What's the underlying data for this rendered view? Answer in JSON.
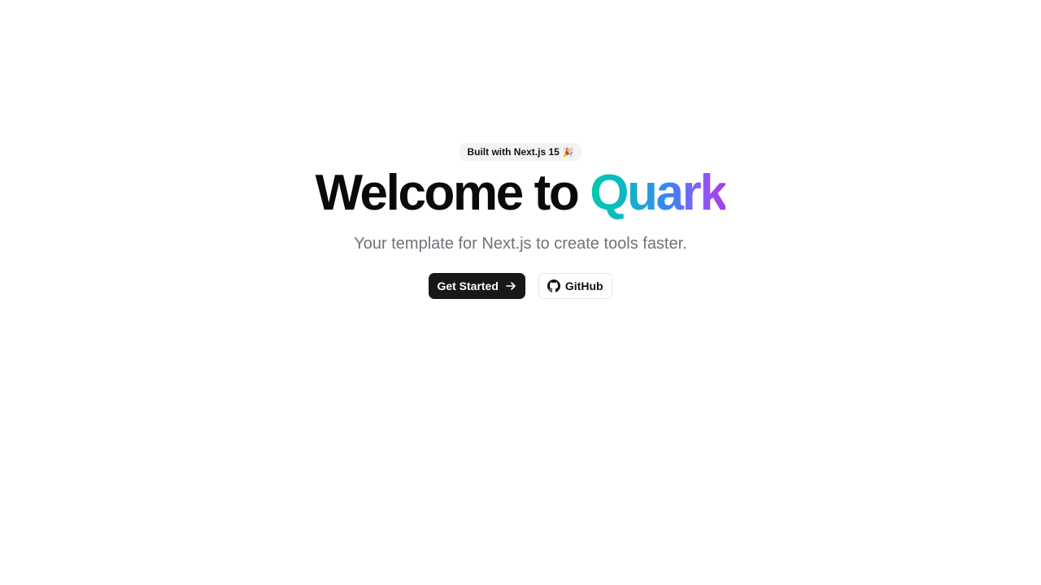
{
  "hero": {
    "badge": {
      "text": "Built with Next.js 15",
      "emoji": "🎉"
    },
    "title": {
      "prefix": "Welcome to",
      "brand": "Quark"
    },
    "subtitle": "Your template for Next.js to create tools faster.",
    "actions": {
      "primary_label": "Get Started",
      "primary_icon": "arrow-right-icon",
      "secondary_label": "GitHub",
      "secondary_icon": "github-icon"
    }
  },
  "colors": {
    "background": "#ffffff",
    "text": "#0a0a0a",
    "muted": "#71717a",
    "primary_button": "#18181b",
    "gradient_start": "#00c9a7",
    "gradient_mid": "#3b82f6",
    "gradient_end": "#a63cf0"
  }
}
